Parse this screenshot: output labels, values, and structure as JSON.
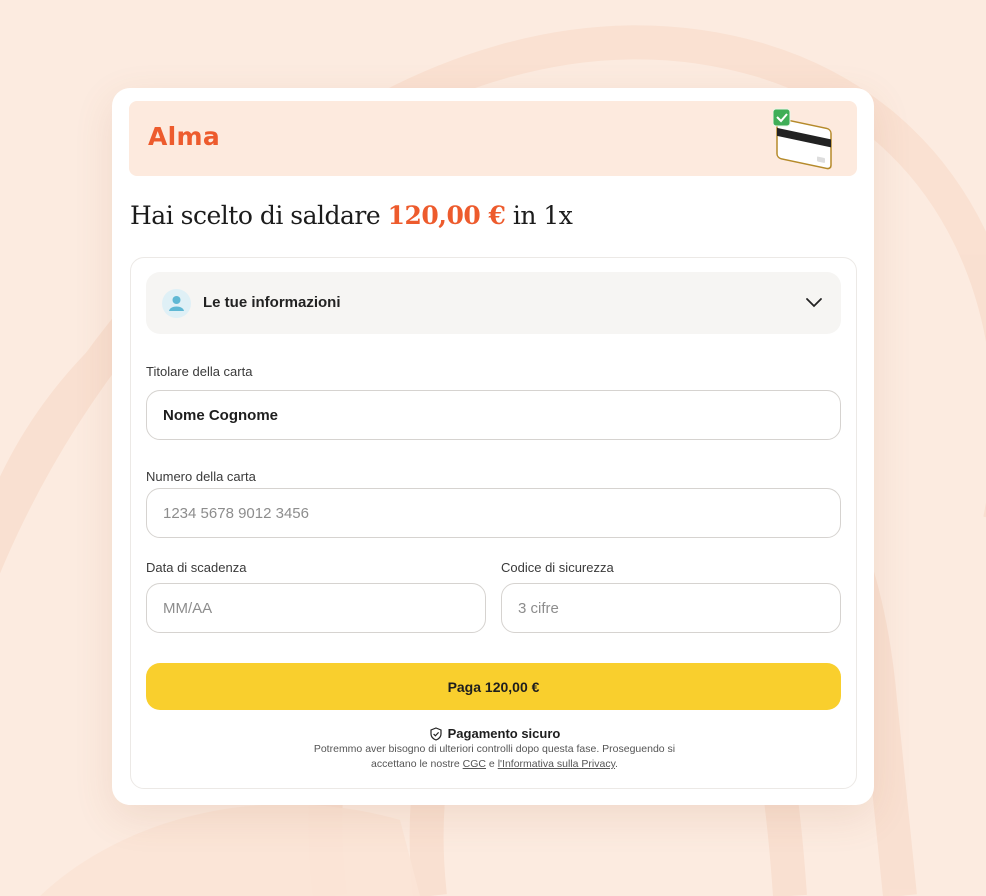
{
  "brand": {
    "logo_text": "Alma",
    "accent_color": "#ed5b2d"
  },
  "header": {
    "title_prefix": "Hai scelto di saldare ",
    "title_amount": "120,00 €",
    "title_suffix": " in 1x"
  },
  "info_section": {
    "label": "Le tue informazioni",
    "icon": "user-icon",
    "toggle_icon": "chevron-down-icon"
  },
  "form": {
    "holder_label": "Titolare della carta",
    "holder_value": "Nome Cognome",
    "number_label": "Numero della carta",
    "number_placeholder": "1234 5678 9012 3456",
    "expiry_label": "Data di scadenza",
    "expiry_placeholder": "MM/AA",
    "cvv_label": "Codice di sicurezza",
    "cvv_placeholder": "3 cifre"
  },
  "pay_button": {
    "label": "Paga 120,00 €",
    "color": "#f9cf2d"
  },
  "footer": {
    "secure_label": "Pagamento sicuro",
    "secure_icon": "shield-check-icon",
    "legal_line1": "Potremmo aver bisogno di ulteriori controlli dopo questa fase. Proseguendo si",
    "legal_prefix": "accettano le nostre ",
    "cgc_link": "CGC",
    "legal_and": " e ",
    "privacy_link": "l'Informativa sulla Privacy",
    "legal_suffix": "."
  }
}
